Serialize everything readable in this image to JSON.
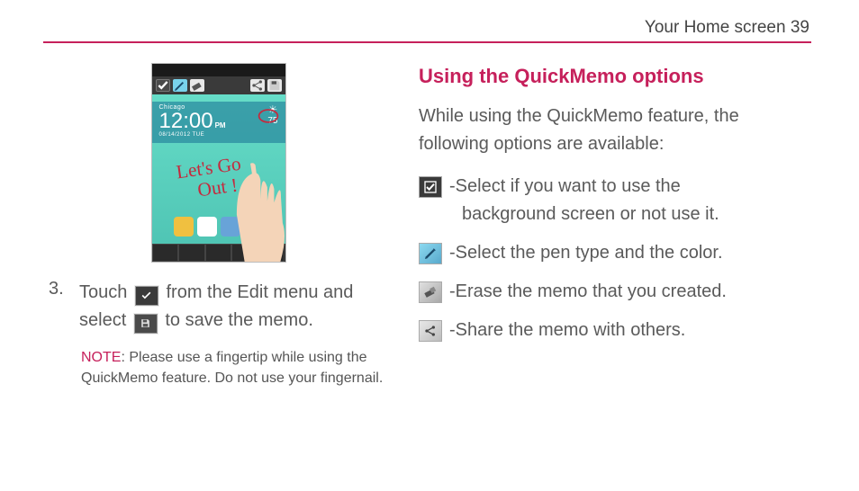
{
  "header": {
    "section": "Your Home screen",
    "page": "39"
  },
  "phone": {
    "city": "Chicago",
    "time": "12:00",
    "ampm": "PM",
    "date": "08/14/2012 TUE",
    "temp": "75",
    "scribble_text": "Let's Go Out!"
  },
  "step": {
    "number": "3.",
    "text_a": "Touch ",
    "text_b": " from the Edit menu and select ",
    "text_c": " to save the memo."
  },
  "note": {
    "label": "NOTE",
    "text": ": Please use a fingertip while using the QuickMemo feature. Do not use your fingernail."
  },
  "right": {
    "heading": "Using the QuickMemo options",
    "intro": "While using the QuickMemo feature, the following options are available:",
    "options": [
      {
        "icon": "check",
        "text_a": " -Select if you want to use the",
        "text_b": "background screen or not use it."
      },
      {
        "icon": "pen",
        "text_a": " -Select the pen type and the color."
      },
      {
        "icon": "erase",
        "text_a": " -Erase the memo that you created."
      },
      {
        "icon": "share",
        "text_a": " -Share the memo with others."
      }
    ]
  }
}
